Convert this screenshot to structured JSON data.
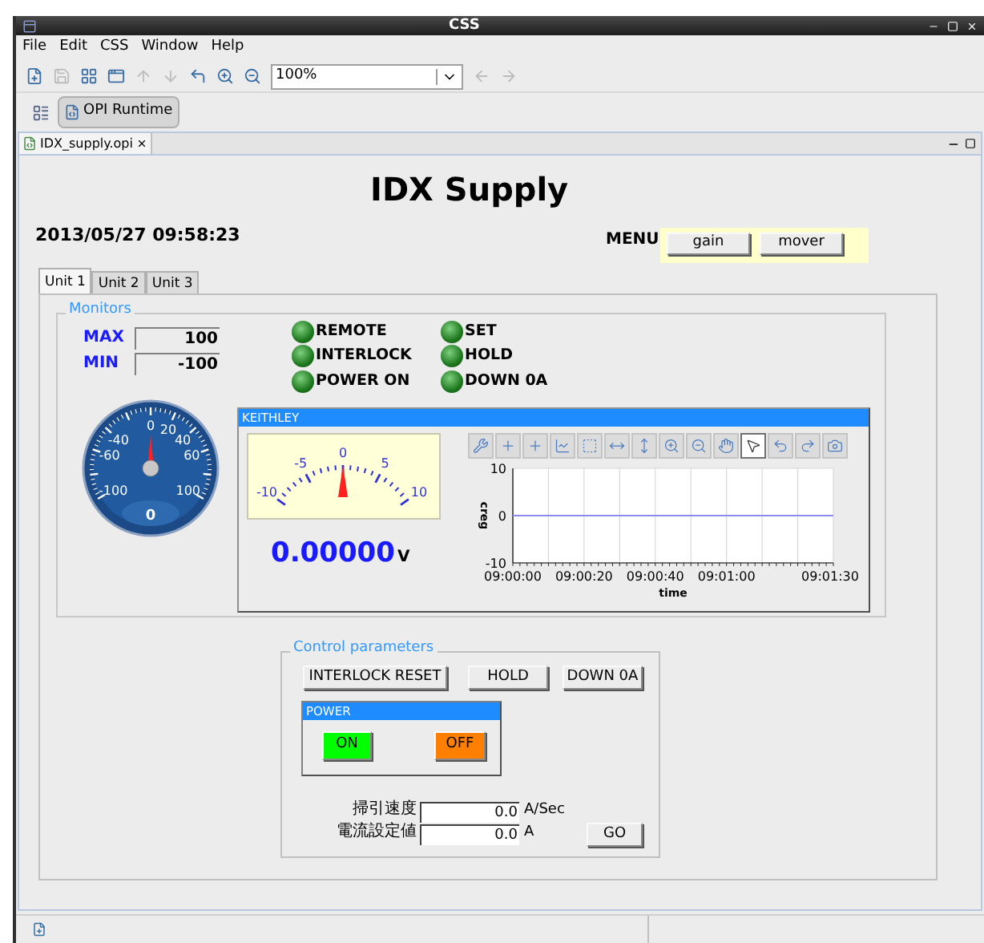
{
  "window": {
    "title": "CSS"
  },
  "menu": [
    "File",
    "Edit",
    "CSS",
    "Window",
    "Help"
  ],
  "toolbar": {
    "buttons": [
      {
        "kind": "new",
        "disabled": false
      },
      {
        "kind": "save",
        "disabled": true
      },
      {
        "kind": "layout",
        "disabled": false
      },
      {
        "kind": "display",
        "disabled": false
      },
      {
        "kind": "up",
        "disabled": true
      },
      {
        "kind": "down",
        "disabled": true
      },
      {
        "kind": "link",
        "disabled": false
      },
      {
        "kind": "zoom-in",
        "disabled": false
      },
      {
        "kind": "zoom-out",
        "disabled": false
      }
    ],
    "zoom": "100%",
    "nav": [
      {
        "kind": "back",
        "disabled": true
      },
      {
        "kind": "forward",
        "disabled": true
      }
    ]
  },
  "perspective": {
    "label": "OPI Runtime",
    "selected": true
  },
  "editor_tab": {
    "label": "IDX_supply.opi"
  },
  "display": {
    "title": "IDX Supply",
    "timestamp": "2013/05/27 09:58:23",
    "menu_label": "MENU",
    "menu_buttons": [
      "gain",
      "mover"
    ],
    "tabs": [
      {
        "label": "Unit 1",
        "selected": true
      },
      {
        "label": "Unit 2",
        "selected": false
      },
      {
        "label": "Unit 3",
        "selected": false
      }
    ],
    "monitors": {
      "legend": "Monitors",
      "limits": [
        {
          "label": "MAX",
          "value": "100"
        },
        {
          "label": "MIN",
          "value": "-100"
        }
      ],
      "leds": [
        {
          "label": "REMOTE",
          "on": true
        },
        {
          "label": "INTERLOCK",
          "on": true
        },
        {
          "label": "POWER ON",
          "on": true
        },
        {
          "label": "SET",
          "on": true
        },
        {
          "label": "HOLD",
          "on": true
        },
        {
          "label": "DOWN 0A",
          "on": true
        }
      ],
      "gauge": {
        "scale_labels": [
          "0",
          "20",
          "-40",
          "40",
          "-60",
          "60",
          "-100",
          "100"
        ],
        "reading": "0"
      },
      "keithley": {
        "title": "KEITHLEY",
        "meter": {
          "scale_labels": [
            "-10",
            "-5",
            "0",
            "5",
            "10"
          ]
        },
        "value": "0.00000",
        "unit": "V",
        "chart_tools": [
          {
            "kind": "config",
            "selected": false
          },
          {
            "kind": "add",
            "selected": false
          },
          {
            "kind": "add",
            "selected": false
          },
          {
            "kind": "autoscale",
            "selected": false
          },
          {
            "kind": "rubberband",
            "selected": false
          },
          {
            "kind": "hzoom",
            "selected": false
          },
          {
            "kind": "vzoom",
            "selected": false
          },
          {
            "kind": "zoom-in",
            "selected": false
          },
          {
            "kind": "zoom-out",
            "selected": false
          },
          {
            "kind": "pan",
            "selected": false
          },
          {
            "kind": "pointer",
            "selected": true
          },
          {
            "kind": "undo",
            "selected": false
          },
          {
            "kind": "redo",
            "selected": false
          },
          {
            "kind": "snapshot",
            "selected": false
          }
        ],
        "chart_data": {
          "type": "line",
          "xlabel": "time",
          "ylabel": "creg",
          "categories": [
            "09:00:00",
            null,
            "09:00:20",
            null,
            "09:00:40",
            null,
            "09:01:00",
            null,
            null,
            "09:01:30"
          ],
          "series": [
            {
              "color": "#8c8cf0",
              "values": [
                0,
                0,
                0,
                0,
                0,
                0,
                0,
                0,
                0,
                0
              ]
            }
          ],
          "ylim": [
            -10,
            10
          ],
          "grid": true,
          "yticks": [
            -10,
            0,
            10
          ]
        }
      }
    },
    "control": {
      "legend": "Control parameters",
      "buttons": [
        "INTERLOCK RESET",
        "HOLD",
        "DOWN 0A"
      ],
      "power": {
        "title": "POWER",
        "on_label": "ON",
        "off_label": "OFF"
      },
      "fields": [
        {
          "label": "掃引速度",
          "value": "0.0",
          "unit": "A/Sec"
        },
        {
          "label": "電流設定値",
          "value": "0.0",
          "unit": "A"
        }
      ],
      "go": "GO"
    }
  }
}
